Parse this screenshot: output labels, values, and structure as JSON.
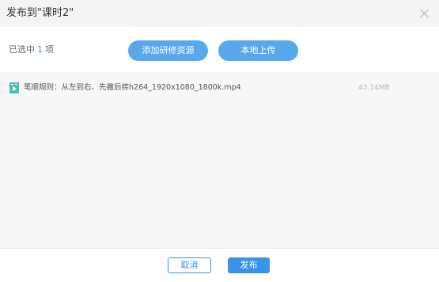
{
  "dialog": {
    "title": "发布到\"课时2\""
  },
  "toolbar": {
    "selected_prefix": "已选中",
    "selected_count": "1",
    "selected_suffix": "项",
    "add_resource_label": "添加研修资源",
    "local_upload_label": "本地上传"
  },
  "files": [
    {
      "icon": "video-file-icon",
      "name": "笔顺规则：从左到右、先撇后捺h264_1920x1080_1800k.mp4",
      "size": "43.14MB"
    }
  ],
  "footer": {
    "cancel_label": "取消",
    "publish_label": "发布"
  },
  "colors": {
    "accent": "#3a93e8",
    "pill_button": "#5aa8ec",
    "video_icon": "#4abfb5"
  }
}
